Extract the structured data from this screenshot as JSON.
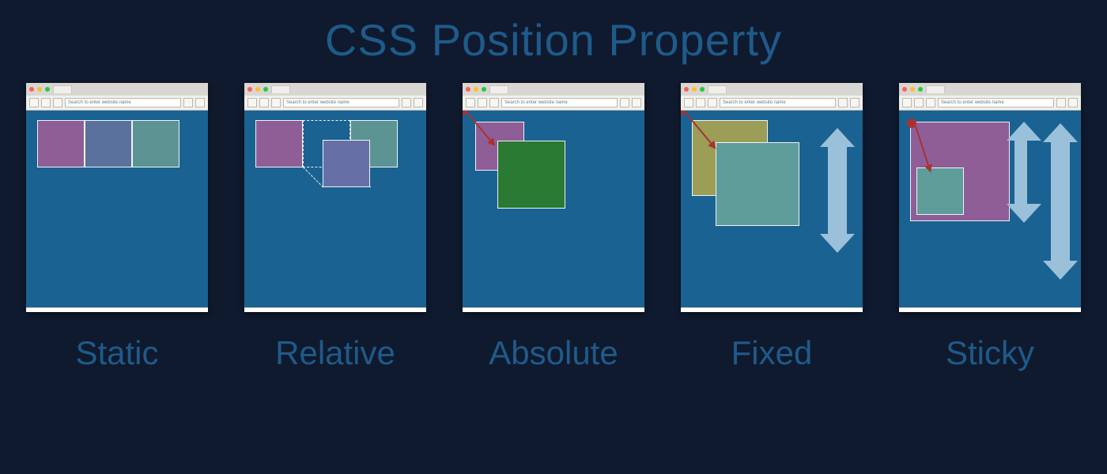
{
  "title": "CSS Position  Property",
  "url_placeholder": "Search to enter website name",
  "panels": [
    {
      "label": "Static"
    },
    {
      "label": "Relative"
    },
    {
      "label": "Absolute"
    },
    {
      "label": "Fixed"
    },
    {
      "label": "Sticky"
    }
  ],
  "colors": {
    "background": "#0f1a2e",
    "viewport": "#1a6291",
    "text": "#1f5a8a",
    "scroll_arrow": "#9ac0da",
    "pin": "#a83232"
  }
}
